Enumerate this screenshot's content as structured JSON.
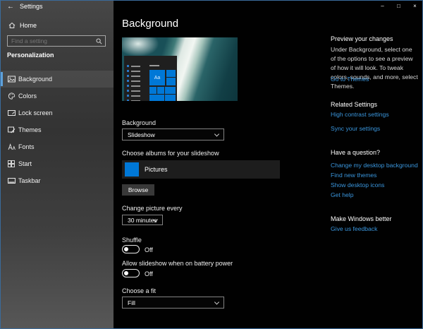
{
  "window": {
    "title": "Settings",
    "caption": {
      "minimize": "–",
      "maximize": "□",
      "close": "×"
    }
  },
  "sidebar": {
    "back_glyph": "←",
    "home_label": "Home",
    "search_placeholder": "Find a setting",
    "section_header": "Personalization",
    "items": [
      {
        "label": "Background",
        "selected": true
      },
      {
        "label": "Colors"
      },
      {
        "label": "Lock screen"
      },
      {
        "label": "Themes"
      },
      {
        "label": "Fonts"
      },
      {
        "label": "Start"
      },
      {
        "label": "Taskbar"
      }
    ]
  },
  "main": {
    "title": "Background",
    "preview": {
      "tile_label": "Aa"
    },
    "background_dropdown": {
      "label": "Background",
      "value": "Slideshow"
    },
    "albums": {
      "label": "Choose albums for your slideshow",
      "album_name": "Pictures",
      "browse_label": "Browse"
    },
    "change_picture": {
      "label": "Change picture every",
      "value": "30 minutes"
    },
    "shuffle": {
      "label": "Shuffle",
      "state": "Off"
    },
    "battery": {
      "label": "Allow slideshow when on battery power",
      "state": "Off"
    },
    "fit": {
      "label": "Choose a fit",
      "value": "Fill"
    }
  },
  "right": {
    "preview_heading": "Preview your changes",
    "preview_body": "Under Background, select one of the options to see a preview of how it will look. To tweak colors, sounds, and more, select Themes.",
    "go_to_themes": "Go to Themes",
    "related_heading": "Related Settings",
    "related_links": [
      "High contrast settings",
      "Sync your settings"
    ],
    "question_heading": "Have a question?",
    "question_links": [
      "Change my desktop background",
      "Find new themes",
      "Show desktop icons",
      "Get help"
    ],
    "feedback_heading": "Make Windows better",
    "feedback_link": "Give us feedback"
  },
  "colors": {
    "accent": "#0078d7",
    "link": "#3a96dd",
    "selected_bar": "#5ea2dc"
  }
}
